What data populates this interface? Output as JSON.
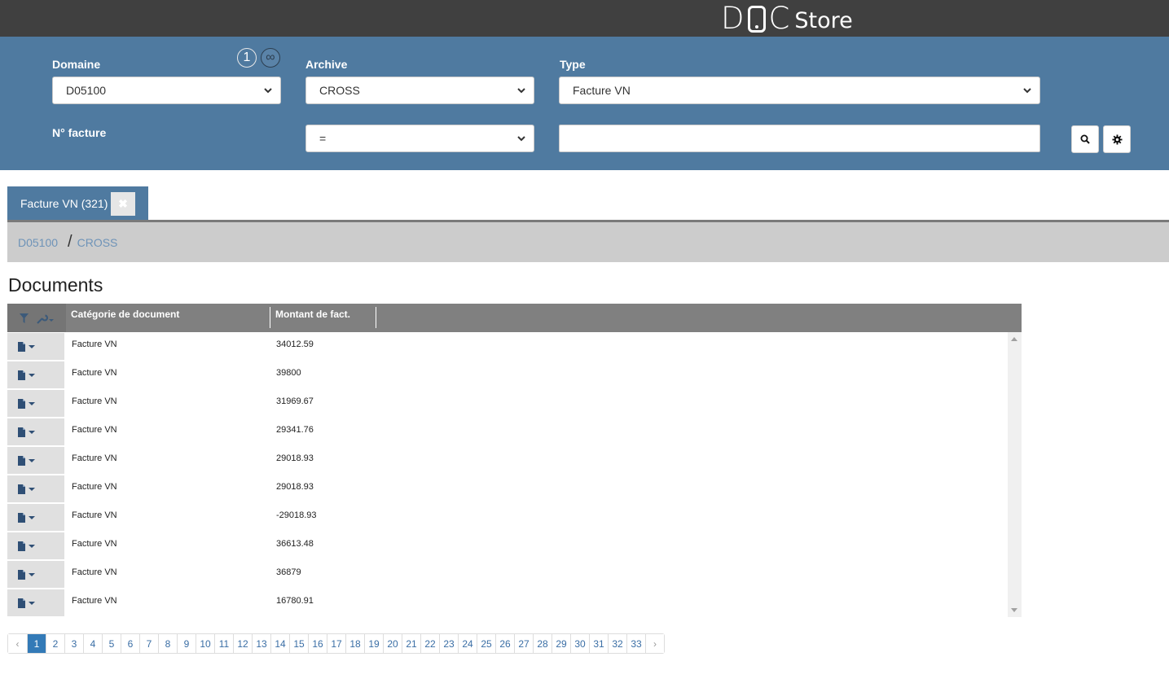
{
  "app": {
    "logo_left": "D",
    "logo_right": "C",
    "logo_suffix": "Store"
  },
  "filters": {
    "domaine": {
      "label": "Domaine",
      "value": "D05100"
    },
    "archive": {
      "label": "Archive",
      "value": "CROSS"
    },
    "type": {
      "label": "Type",
      "value": "Facture VN"
    },
    "num_facture": {
      "label": "N° facture",
      "operator": "=",
      "value": ""
    },
    "badge_one": "1",
    "badge_infinity": "∞",
    "search_icon": "search-icon",
    "settings_icon": "gear-icon"
  },
  "tab": {
    "label": "Facture VN (321)",
    "close": "✖"
  },
  "breadcrumb": {
    "first": "D05100",
    "separator": "/",
    "second": "CROSS"
  },
  "documents": {
    "title": "Documents",
    "columns": [
      "Catégorie de document",
      "Montant de fact."
    ],
    "rows": [
      {
        "category": "Facture VN",
        "amount": "34012.59"
      },
      {
        "category": "Facture VN",
        "amount": "39800"
      },
      {
        "category": "Facture VN",
        "amount": "31969.67"
      },
      {
        "category": "Facture VN",
        "amount": "29341.76"
      },
      {
        "category": "Facture VN",
        "amount": "29018.93"
      },
      {
        "category": "Facture VN",
        "amount": "29018.93"
      },
      {
        "category": "Facture VN",
        "amount": "-29018.93"
      },
      {
        "category": "Facture VN",
        "amount": "36613.48"
      },
      {
        "category": "Facture VN",
        "amount": "36879"
      },
      {
        "category": "Facture VN",
        "amount": "16780.91"
      }
    ]
  },
  "pagination": {
    "prev": "‹",
    "next": "›",
    "current": 1,
    "pages": [
      "1",
      "2",
      "3",
      "4",
      "5",
      "6",
      "7",
      "8",
      "9",
      "10",
      "11",
      "12",
      "13",
      "14",
      "15",
      "16",
      "17",
      "18",
      "19",
      "20",
      "21",
      "22",
      "23",
      "24",
      "25",
      "26",
      "27",
      "28",
      "29",
      "30",
      "31",
      "32",
      "33"
    ]
  },
  "colors": {
    "topbar": "#404040",
    "panel": "#4f7aa0",
    "header": "#808080",
    "active_page": "#337ab7"
  }
}
